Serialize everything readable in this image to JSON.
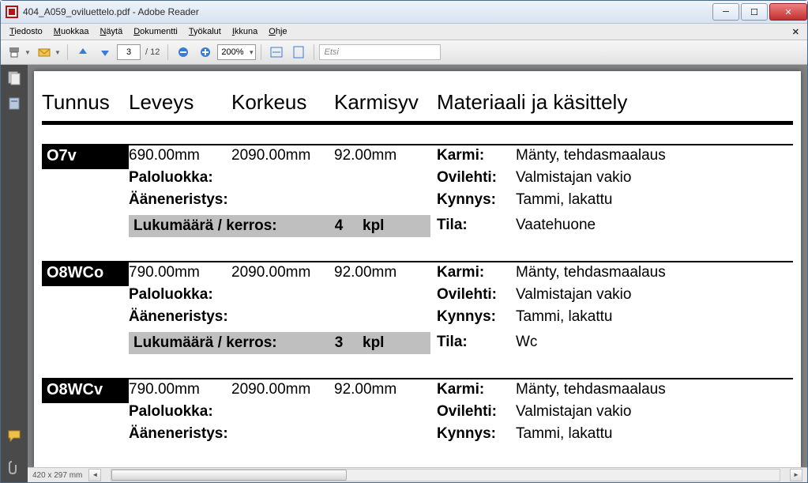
{
  "window": {
    "title": "404_A059_oviluettelo.pdf - Adobe Reader",
    "btn_min": "─",
    "btn_max": "☐",
    "btn_close": "✕"
  },
  "menu": {
    "items": [
      "Tiedosto",
      "Muokkaa",
      "Näytä",
      "Dokumentti",
      "Työkalut",
      "Ikkuna",
      "Ohje"
    ]
  },
  "toolbar": {
    "page_current": "3",
    "page_total": "/ 12",
    "zoom": "200%",
    "search_placeholder": "Etsi"
  },
  "doc": {
    "headers": [
      "Tunnus",
      "Leveys",
      "Korkeus",
      "Karmisyv",
      "Materiaali ja käsittely"
    ],
    "labels": {
      "paloluokka": "Paloluokka:",
      "aaneneristys": "Ääneneristys:",
      "lukumaara": "Lukumäärä / kerros:",
      "kpl": "kpl",
      "karmi": "Karmi:",
      "ovilehti": "Ovilehti:",
      "kynnys": "Kynnys:",
      "tila": "Tila:"
    },
    "entries": [
      {
        "id": "O7v",
        "leveys": "690.00mm",
        "korkeus": "2090.00mm",
        "karmisyv": "92.00mm",
        "count": "4",
        "karmi": "Mänty, tehdasmaalaus",
        "ovilehti": "Valmistajan vakio",
        "kynnys": "Tammi, lakattu",
        "tila": "Vaatehuone"
      },
      {
        "id": "O8WCo",
        "leveys": "790.00mm",
        "korkeus": "2090.00mm",
        "karmisyv": "92.00mm",
        "count": "3",
        "karmi": "Mänty, tehdasmaalaus",
        "ovilehti": "Valmistajan vakio",
        "kynnys": "Tammi, lakattu",
        "tila": "Wc"
      },
      {
        "id": "O8WCv",
        "leveys": "790.00mm",
        "korkeus": "2090.00mm",
        "karmisyv": "92.00mm",
        "count": "",
        "karmi": "Mänty, tehdasmaalaus",
        "ovilehti": "Valmistajan vakio",
        "kynnys": "Tammi, lakattu",
        "tila": ""
      }
    ]
  },
  "status": {
    "dims": "420 x 297 mm"
  }
}
